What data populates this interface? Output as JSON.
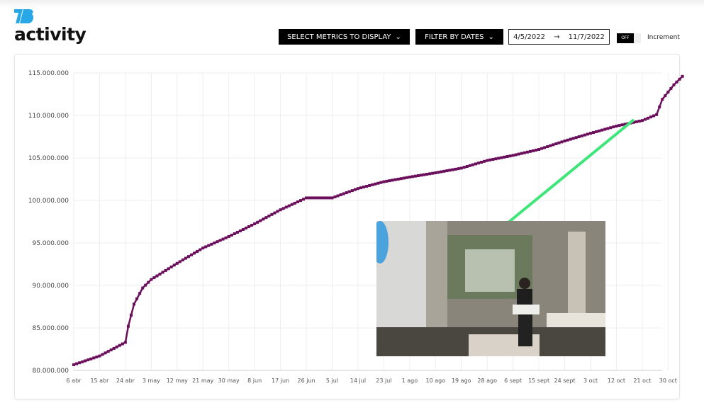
{
  "header": {
    "logo": "TB",
    "title": "activity"
  },
  "toolbar": {
    "metrics_label": "SELECT METRICS TO DISPLAY",
    "dates_label": "FILTER BY DATES",
    "date_from": "4/5/2022",
    "arrow": "→",
    "date_to": "11/7/2022",
    "toggle_state": "OFF",
    "toggle_label": "Increment"
  },
  "colors": {
    "line": "#6b0f5c",
    "logo": "#29a8e8",
    "annotation": "#3ee67a"
  },
  "chart_data": {
    "type": "line",
    "title": "",
    "xlabel": "",
    "ylabel": "",
    "grid": true,
    "ylim": [
      80000000,
      115000000
    ],
    "y_ticks": [
      "80.000.000",
      "85.000.000",
      "90.000.000",
      "95.000.000",
      "100.000.000",
      "105.000.000",
      "110.000.000",
      "115.000.000"
    ],
    "x_ticks": [
      "6 abr",
      "15 abr",
      "24 abr",
      "3 may",
      "12 may",
      "21 may",
      "30 may",
      "8 jun",
      "17 jun",
      "26 jun",
      "5 jul",
      "14 jul",
      "23 jul",
      "1 ago",
      "10 ago",
      "19 ago",
      "28 ago",
      "6 sept",
      "15 sept",
      "24 sept",
      "3 oct",
      "12 oct",
      "21 oct",
      "30 oct"
    ],
    "x_tick_dates": [
      "2022-04-06",
      "2022-04-15",
      "2022-04-24",
      "2022-05-03",
      "2022-05-12",
      "2022-05-21",
      "2022-05-30",
      "2022-06-08",
      "2022-06-17",
      "2022-06-26",
      "2022-07-05",
      "2022-07-14",
      "2022-07-23",
      "2022-08-01",
      "2022-08-10",
      "2022-08-19",
      "2022-08-28",
      "2022-09-06",
      "2022-09-15",
      "2022-09-24",
      "2022-10-03",
      "2022-10-12",
      "2022-10-21",
      "2022-10-30"
    ],
    "xlim": [
      "2022-04-06",
      "2022-11-07"
    ],
    "series": [
      {
        "x": [
          "2022-04-06",
          "2022-04-15",
          "2022-04-24",
          "2022-04-25",
          "2022-04-27",
          "2022-04-30",
          "2022-05-03",
          "2022-05-12",
          "2022-05-21",
          "2022-05-30",
          "2022-06-08",
          "2022-06-17",
          "2022-06-26",
          "2022-07-05",
          "2022-07-14",
          "2022-07-23",
          "2022-08-01",
          "2022-08-10",
          "2022-08-19",
          "2022-08-28",
          "2022-09-06",
          "2022-09-15",
          "2022-09-24",
          "2022-10-03",
          "2022-10-12",
          "2022-10-21",
          "2022-10-26",
          "2022-10-28",
          "2022-11-01",
          "2022-11-04"
        ],
        "y": [
          80670000,
          81700000,
          83300000,
          85200000,
          87800000,
          89700000,
          90700000,
          92600000,
          94400000,
          95750000,
          97250000,
          98900000,
          100300000,
          100300000,
          101400000,
          102200000,
          102750000,
          103250000,
          103800000,
          104700000,
          105300000,
          106000000,
          107000000,
          107900000,
          108750000,
          109400000,
          110100000,
          111900000,
          113600000,
          114600000
        ]
      }
    ],
    "annotation": {
      "type": "video-inset",
      "pointer": "green line to late October"
    }
  }
}
